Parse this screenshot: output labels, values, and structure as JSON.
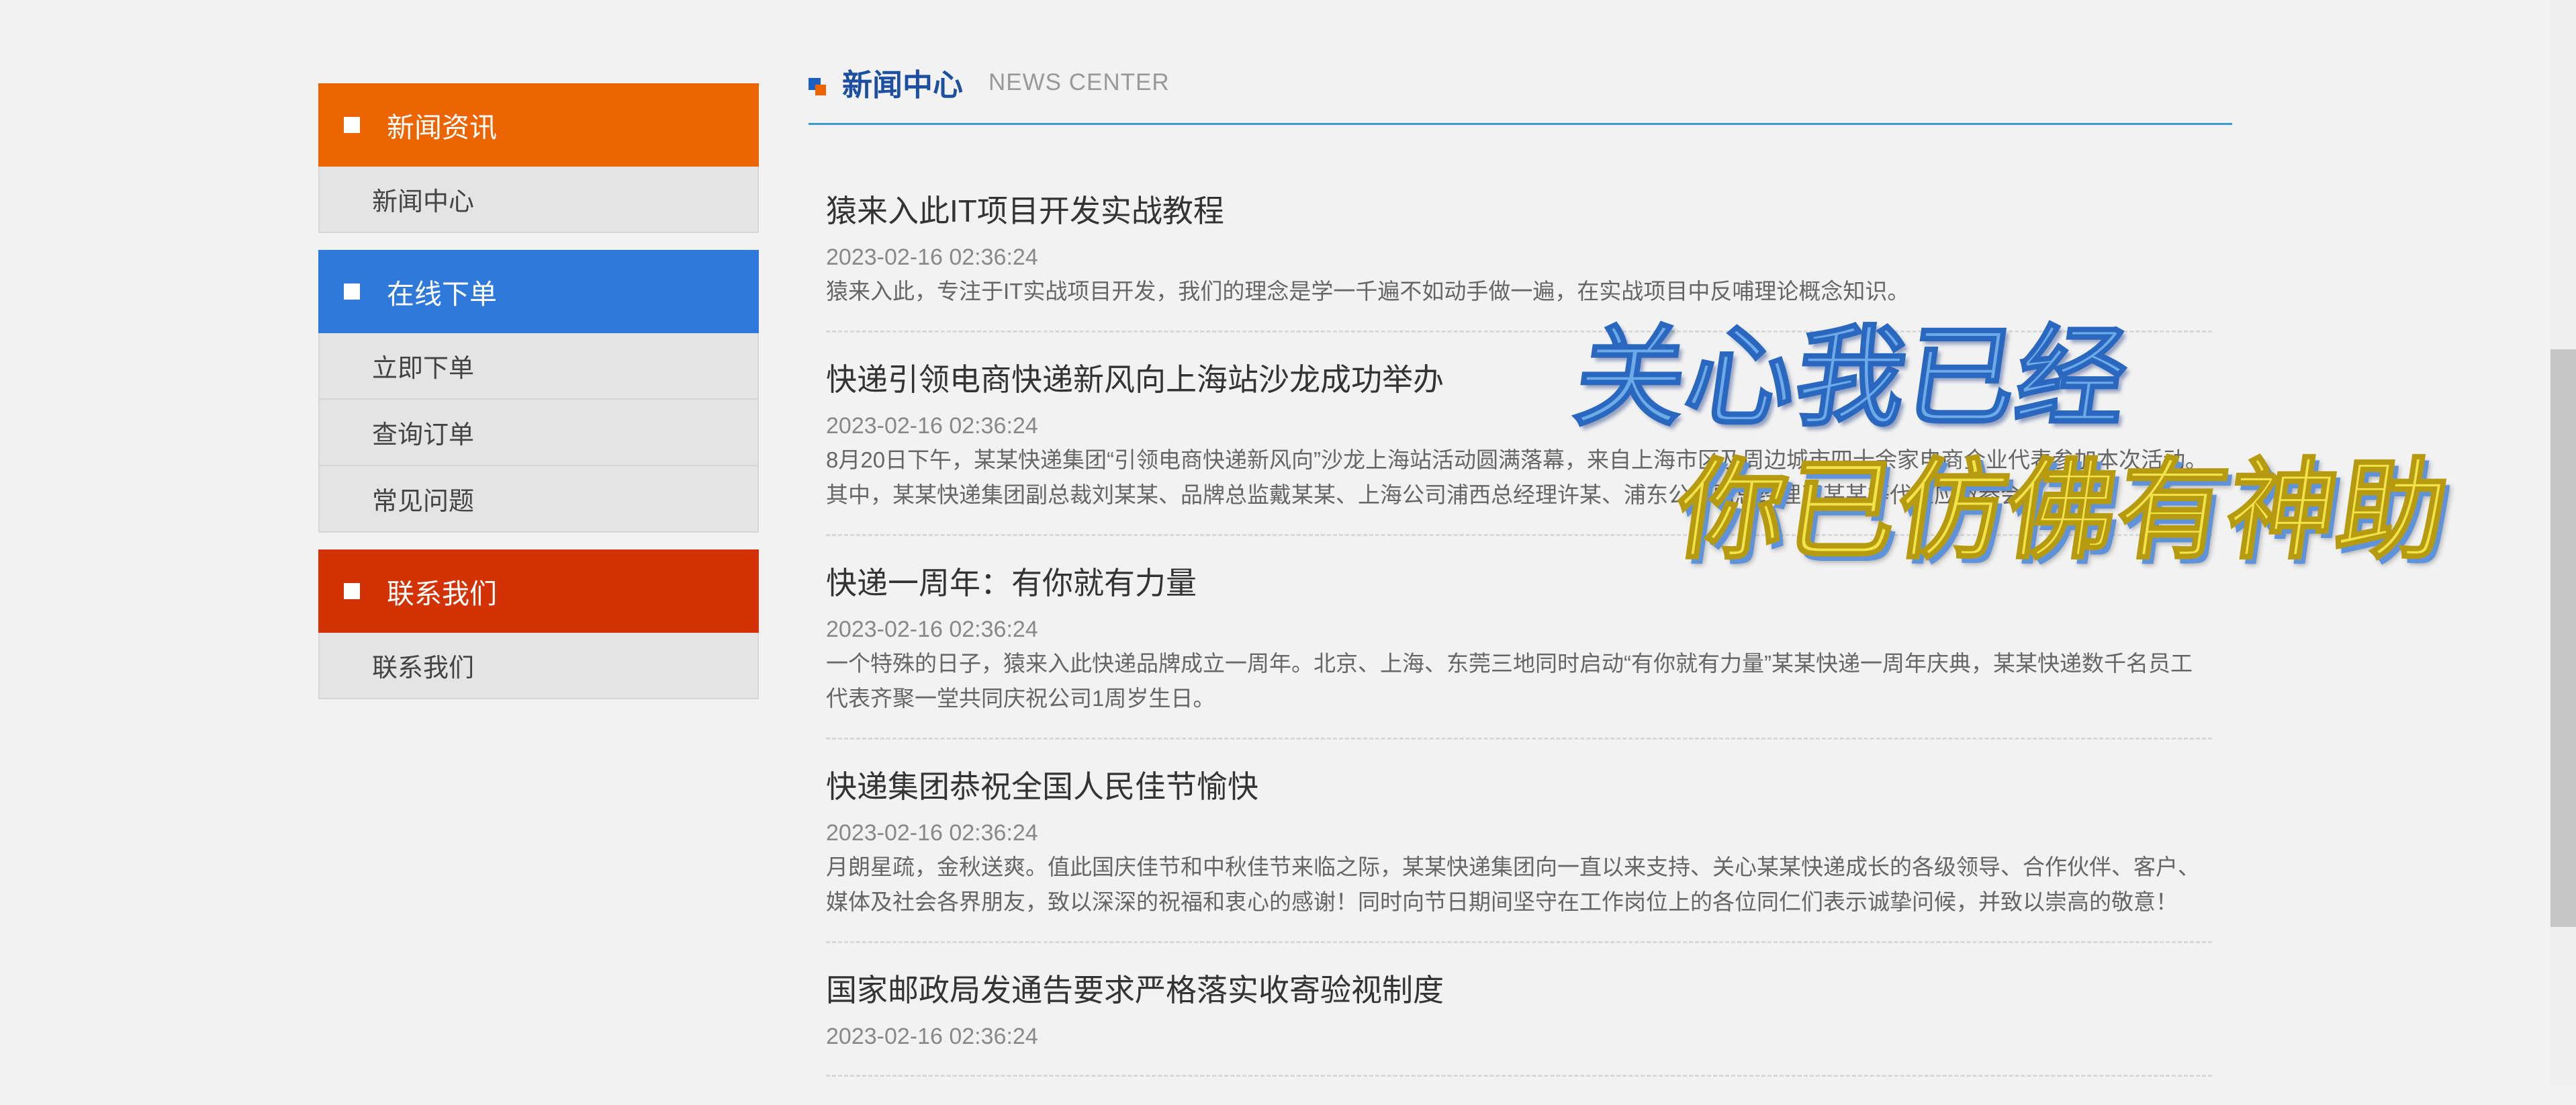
{
  "sidebar": {
    "groups": [
      {
        "title": "新闻资讯",
        "items": [
          "新闻中心"
        ]
      },
      {
        "title": "在线下单",
        "items": [
          "立即下单",
          "查询订单",
          "常见问题"
        ]
      },
      {
        "title": "联系我们",
        "items": [
          "联系我们"
        ]
      }
    ]
  },
  "main": {
    "title": "新闻中心",
    "subtitle": "NEWS CENTER",
    "news": [
      {
        "title": "猿来入此IT项目开发实战教程",
        "date": "2023-02-16 02:36:24",
        "desc": "猿来入此，专注于IT实战项目开发，我们的理念是学一千遍不如动手做一遍，在实战项目中反哺理论概念知识。"
      },
      {
        "title": "快递引领电商快递新风向上海站沙龙成功举办",
        "date": "2023-02-16 02:36:24",
        "desc": "8月20日下午，某某快递集团“引领电商快递新风向”沙龙上海站活动圆满落幕，来自上海市区及周边城市四十余家电商企业代表参加本次活动。其中，某某快递集团副总裁刘某某、品牌总监戴某某、上海公司浦西总经理许某、浦东公司副总经理王某某等代表应邀参会。"
      },
      {
        "title": "快递一周年：有你就有力量",
        "date": "2023-02-16 02:36:24",
        "desc": "一个特殊的日子，猿来入此快递品牌成立一周年。北京、上海、东莞三地同时启动“有你就有力量”某某快递一周年庆典，某某快递数千名员工代表齐聚一堂共同庆祝公司1周岁生日。"
      },
      {
        "title": "快递集团恭祝全国人民佳节愉快",
        "date": "2023-02-16 02:36:24",
        "desc": "月朗星疏，金秋送爽。值此国庆佳节和中秋佳节来临之际，某某快递集团向一直以来支持、关心某某快递成长的各级领导、合作伙伴、客户、媒体及社会各界朋友，致以深深的祝福和衷心的感谢！同时向节日期间坚守在工作岗位上的各位同仁们表示诚挚问候，并致以崇高的敬意！"
      },
      {
        "title": "国家邮政局发通告要求严格落实收寄验视制度",
        "date": "2023-02-16 02:36:24",
        "desc": ""
      }
    ]
  },
  "overlay": {
    "line1": "关心我已经",
    "line2": "你已仿佛有神助"
  },
  "colors": {
    "news_group": "#ec6400",
    "order_group": "#2e79d9",
    "contact_group": "#d33204",
    "header_rule": "#3a9ad8",
    "title_blue": "#1c4fa1"
  }
}
